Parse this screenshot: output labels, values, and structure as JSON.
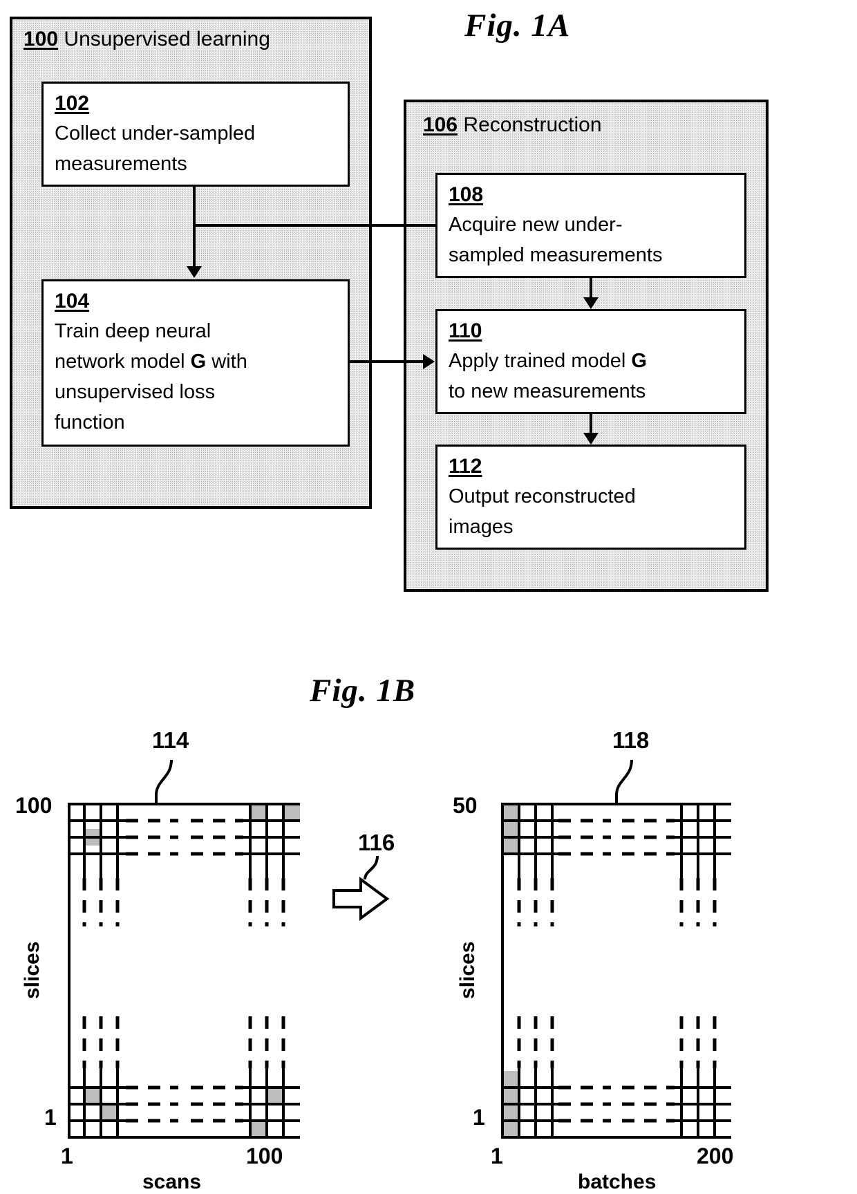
{
  "figures": {
    "fig_1a_title": "Fig. 1A",
    "fig_1b_title": "Fig. 1B"
  },
  "fig_1a": {
    "containers": [
      {
        "ref": "100",
        "label": "Unsupervised learning"
      },
      {
        "ref": "106",
        "label": "Reconstruction"
      }
    ],
    "steps": [
      {
        "ref": "102",
        "line1": "Collect under-sampled",
        "line2": "measurements",
        "line3": "",
        "line4": ""
      },
      {
        "ref": "104",
        "line1": "Train deep neural",
        "line2_a": "network model ",
        "line2_b": "G",
        "line2_c": " with",
        "line3": "unsupervised loss",
        "line4": "function"
      },
      {
        "ref": "108",
        "line1": "Acquire new under-",
        "line2": "sampled measurements",
        "line3": "",
        "line4": ""
      },
      {
        "ref": "110",
        "line1_a": "Apply trained model ",
        "line1_b": "G",
        "line2": "to new measurements",
        "line3": "",
        "line4": ""
      },
      {
        "ref": "112",
        "line1": "Output reconstructed",
        "line2": "images",
        "line3": "",
        "line4": ""
      }
    ]
  },
  "fig_1b": {
    "callouts": {
      "left_grid": "114",
      "right_grid": "118",
      "transform_arrow": "116"
    },
    "left_chart": {
      "y_axis_label": "slices",
      "y_top_tick": "100",
      "y_bottom_tick": "1",
      "x_axis_label": "scans",
      "x_left_tick": "1",
      "x_right_tick": "100"
    },
    "right_chart": {
      "y_axis_label": "slices",
      "y_top_tick": "50",
      "y_bottom_tick": "1",
      "x_axis_label": "batches",
      "x_left_tick": "1",
      "x_right_tick": "200"
    },
    "colors": {
      "line": "#000000",
      "shaded_cell": "#b9b9b9",
      "background": "#ffffff"
    }
  }
}
